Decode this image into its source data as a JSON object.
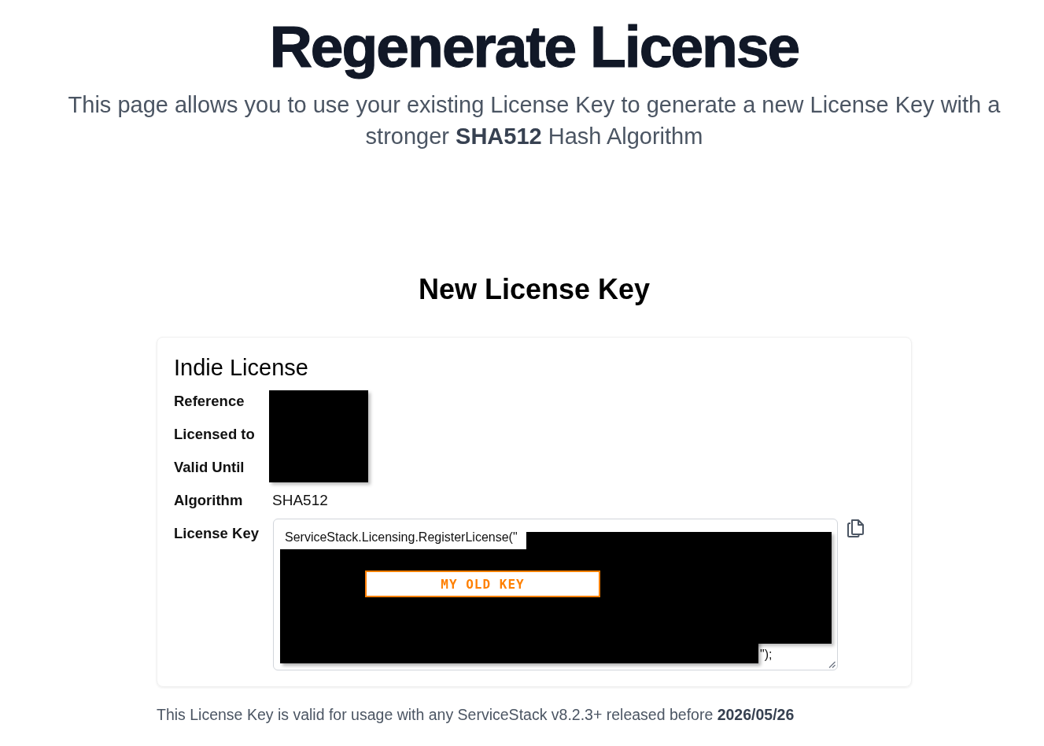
{
  "page": {
    "title": "Regenerate License",
    "subtitle": "This page allows you to use your existing License Key to generate a new License Key with a stronger **SHA512** Hash Algorithm"
  },
  "section": {
    "heading": "New License Key"
  },
  "license_card": {
    "title": "Indie License",
    "fields": [
      {
        "label": "Reference",
        "kind": "redacted"
      },
      {
        "label": "Licensed to",
        "kind": "redacted"
      },
      {
        "label": "Valid Until",
        "kind": "redacted"
      },
      {
        "label": "Algorithm",
        "kind": "text",
        "value": "SHA512"
      },
      {
        "label": "License Key",
        "kind": "code",
        "code_start": "ServiceStack.Licensing.RegisterLicense(\"",
        "code_end": "\");",
        "annotation": "MY OLD KEY"
      }
    ]
  },
  "footer": "This License Key is valid for usage with any ServiceStack v8.2.3+ released before **2026/05/26**"
}
